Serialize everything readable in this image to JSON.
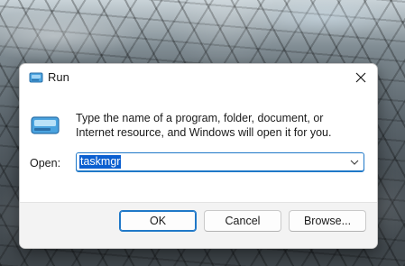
{
  "dialog": {
    "title": "Run",
    "description": "Type the name of a program, folder, document, or Internet resource, and Windows will open it for you.",
    "open_label": "Open:",
    "open_value": "taskmgr",
    "buttons": {
      "ok": "OK",
      "cancel": "Cancel",
      "browse": "Browse..."
    }
  },
  "icons": {
    "title": "run-app-icon",
    "content": "run-app-icon",
    "close": "close-icon",
    "dropdown": "chevron-down-icon"
  },
  "colors": {
    "accent": "#1f78c8",
    "selection": "#0b5fd0"
  }
}
